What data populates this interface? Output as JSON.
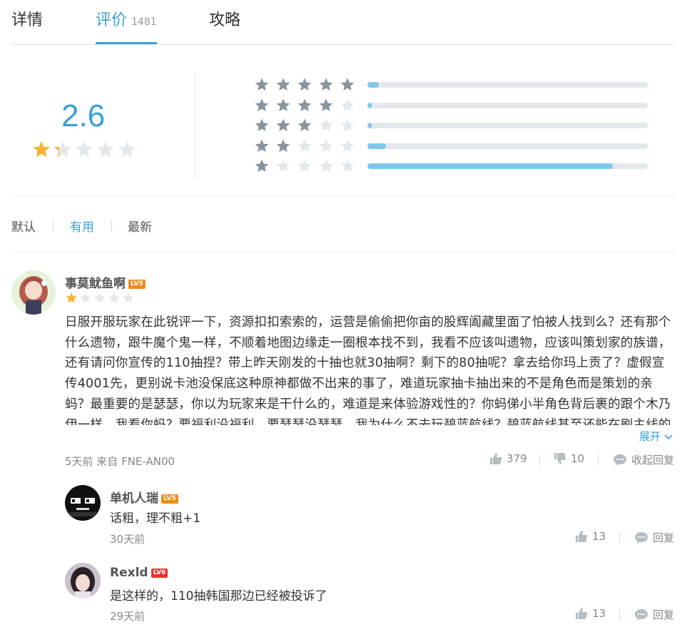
{
  "tabs": [
    {
      "label": "详情",
      "active": false
    },
    {
      "label": "评价",
      "count": "1481",
      "active": true
    },
    {
      "label": "攻略",
      "active": false
    }
  ],
  "summary": {
    "score": "2.6",
    "score_stars_filled": 1.3,
    "distribution": [
      {
        "stars": 5,
        "fraction": 0.04
      },
      {
        "stars": 4,
        "fraction": 0.015
      },
      {
        "stars": 3,
        "fraction": 0.015
      },
      {
        "stars": 2,
        "fraction": 0.065
      },
      {
        "stars": 1,
        "fraction": 0.875
      }
    ]
  },
  "sort": [
    {
      "label": "默认",
      "active": false
    },
    {
      "label": "有用",
      "active": true
    },
    {
      "label": "最新",
      "active": false
    }
  ],
  "review": {
    "username": "事莫鱿鱼啊",
    "level": "LV5",
    "stars": 1,
    "text": "日服开服玩家在此锐评一下，资源扣扣索索的，运营是偷偷把你亩的股辉阖藏里面了怕被人找到么？还有那个什么遗物，跟牛魔个鬼一样，不顺着地图边缘走一圈根本找不到，我看不应该叫遗物，应该叫策划家的族谱，还有请问你宣传的110抽捏？带上昨天刚发的十抽也就30抽啊？剩下的80抽呢？拿去给你玛上贡了？虚假宣传4001先，更别说卡池没保底这种原神都做不出来的事了，难道玩家抽卡抽出来的不是角色而是策划的亲蚂？最重要的是瑟瑟，你以为玩家来是干什么的，难道是来体验游戏性的？你蚂俤小半角色背后裹的跟个木乃伊一样，我看你蚂？要福利没福利，要瑟瑟没瑟瑟，我为什么不去玩碧蓝航线？碧蓝航线甚至还能在刷主线的时候爽一",
    "expand_label": "展开",
    "time_device": "5天前 来自 FNE-AN00",
    "likes": "379",
    "dislikes": "10",
    "collapse_label": "收起回复"
  },
  "replies": [
    {
      "username": "单机人瑞",
      "level": "LV5",
      "level_color": "orange",
      "text": "话粗，理不粗+1",
      "time": "30天前",
      "likes": "13",
      "reply_label": "回复"
    },
    {
      "username": "Rexld",
      "level": "LV6",
      "level_color": "red",
      "text": "是这样的，110抽韩国那边已经被投诉了",
      "time": "29天前",
      "likes": "13",
      "reply_label": "回复"
    }
  ],
  "colors": {
    "accent": "#3aa0d8",
    "star_filled": "#f5b335",
    "star_dark": "#8a949c",
    "star_light": "#e3e8ec",
    "bar": "#7ec8ef"
  }
}
